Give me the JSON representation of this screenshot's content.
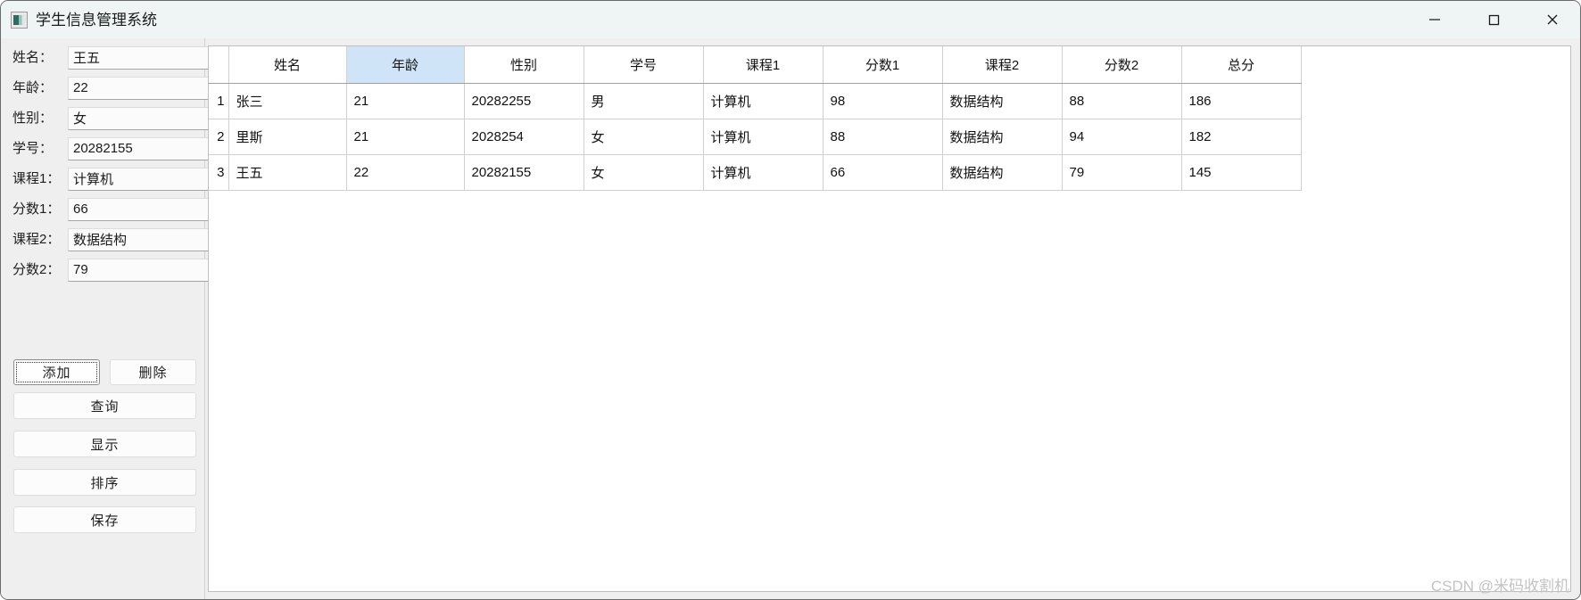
{
  "window": {
    "title": "学生信息管理系统",
    "icon": "app-window-icon",
    "controls": {
      "minimize": "minimize-icon",
      "maximize": "maximize-icon",
      "close": "close-icon"
    }
  },
  "form": {
    "fields": [
      {
        "label": "姓名：",
        "value": "王五",
        "placeholder": ""
      },
      {
        "label": "年龄：",
        "value": "22",
        "placeholder": ""
      },
      {
        "label": "性别：",
        "value": "女",
        "placeholder": ""
      },
      {
        "label": "学号：",
        "value": "20282155",
        "placeholder": ""
      },
      {
        "label": "课程1：",
        "value": "计算机",
        "placeholder": ""
      },
      {
        "label": "分数1：",
        "value": "66",
        "placeholder": ""
      },
      {
        "label": "课程2：",
        "value": "数据结构",
        "placeholder": ""
      },
      {
        "label": "分数2：",
        "value": "79",
        "placeholder": ""
      }
    ],
    "buttons": {
      "add": "添加",
      "delete": "删除",
      "query": "查询",
      "show": "显示",
      "sort": "排序",
      "save": "保存"
    },
    "focused_button": "add"
  },
  "table": {
    "headers": [
      "姓名",
      "年龄",
      "性别",
      "学号",
      "课程1",
      "分数1",
      "课程2",
      "分数2",
      "总分"
    ],
    "selected_column": "年龄",
    "selected_column_color": "#cfe4f7",
    "rows": [
      {
        "num": "1",
        "cells": [
          "张三",
          "21",
          "20282255",
          "男",
          "计算机",
          "98",
          "数据结构",
          "88",
          "186"
        ]
      },
      {
        "num": "2",
        "cells": [
          "里斯",
          "21",
          "2028254",
          "女",
          "计算机",
          "88",
          "数据结构",
          "94",
          "182"
        ]
      },
      {
        "num": "3",
        "cells": [
          "王五",
          "22",
          "20282155",
          "女",
          "计算机",
          "66",
          "数据结构",
          "79",
          "145"
        ]
      }
    ]
  },
  "watermark": "CSDN @米码收割机"
}
